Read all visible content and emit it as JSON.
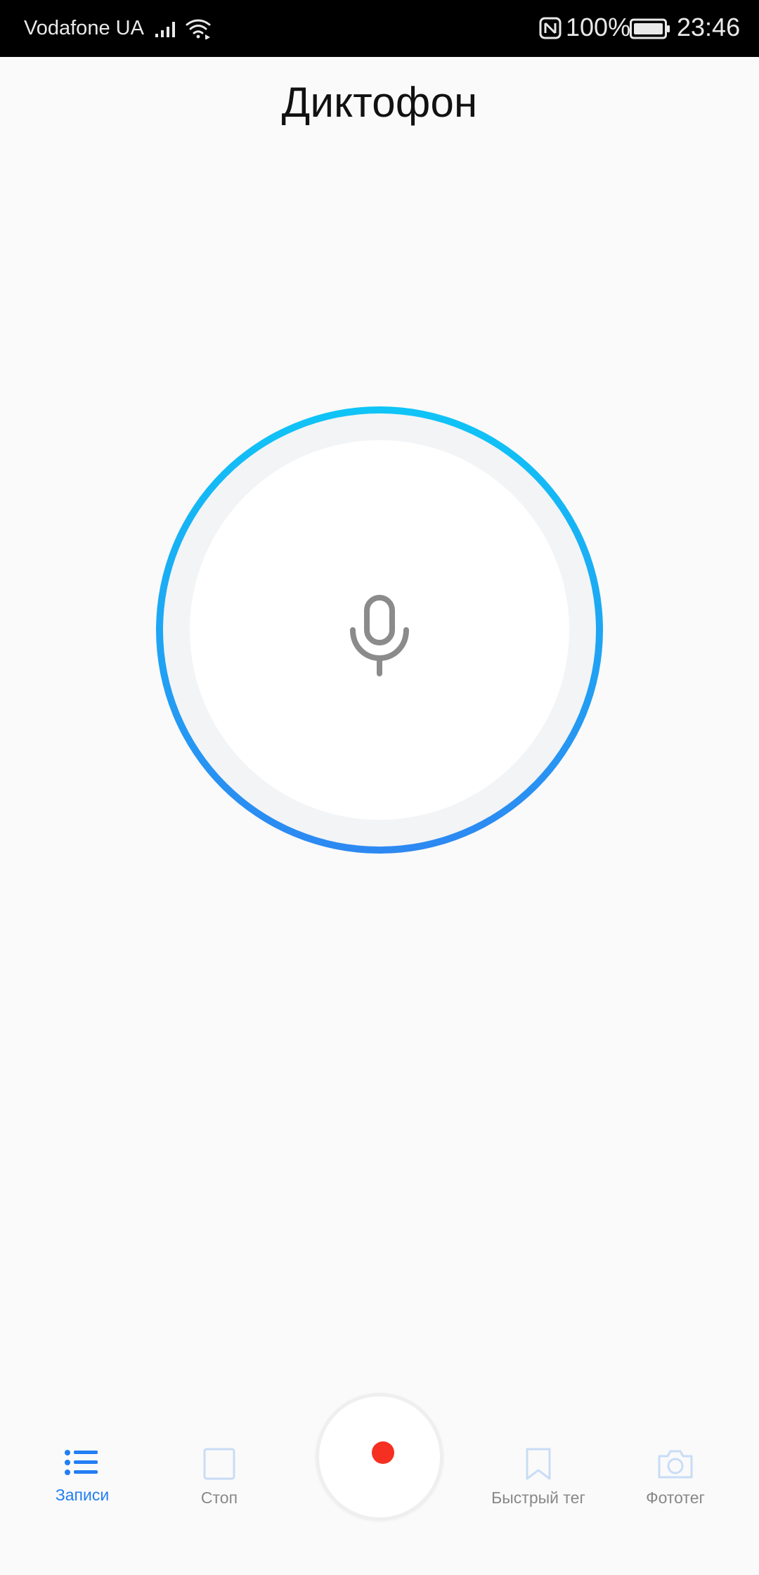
{
  "status_bar": {
    "carrier": "Vodafone UA",
    "battery": "100%",
    "time": "23:46",
    "icons": [
      "signal-icon",
      "wifi-icon",
      "nfc-icon",
      "battery-icon"
    ]
  },
  "header": {
    "title": "Диктофон"
  },
  "recorder": {
    "icon": "microphone-icon",
    "ring_gradient": [
      "#0fc4f6",
      "#2d88f2"
    ],
    "inner_ring_color": "#f2f4f6"
  },
  "bottom_nav": {
    "items": [
      {
        "label": "Записи",
        "icon": "list-icon",
        "active": true
      },
      {
        "label": "Стоп",
        "icon": "stop-icon",
        "active": false
      },
      {
        "label": "Быстрый тег",
        "icon": "bookmark-icon",
        "active": false
      },
      {
        "label": "Фототег",
        "icon": "camera-icon",
        "active": false
      }
    ],
    "record_button": {
      "icon": "record-icon",
      "dot_color": "#f52f22"
    }
  },
  "colors": {
    "accent": "#237ef3",
    "inactive": "#888888",
    "disabled_icon": "#c9dcf6"
  }
}
